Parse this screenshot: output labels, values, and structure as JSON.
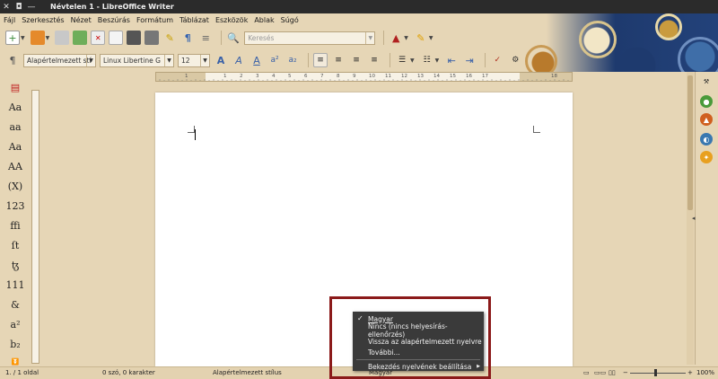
{
  "window": {
    "title": "Névtelen 1 - LibreOffice Writer",
    "close_glyph": "✕",
    "maximize_glyph": "◘",
    "minimize_glyph": "—"
  },
  "menu": [
    "Fájl",
    "Szerkesztés",
    "Nézet",
    "Beszúrás",
    "Formátum",
    "Táblázat",
    "Eszközök",
    "Ablak",
    "Súgó"
  ],
  "toolbar": {
    "search_placeholder": "Keresés",
    "paragraph_style": "Alapértelmezett stí",
    "font_name": "Linux Libertine G",
    "font_size": "12"
  },
  "ruler": {
    "numbers": [
      "1",
      "1",
      "2",
      "3",
      "4",
      "5",
      "6",
      "7",
      "8",
      "9",
      "10",
      "11",
      "12",
      "13",
      "14",
      "15",
      "16",
      "17",
      "18"
    ]
  },
  "sidebar_styles": [
    "Aa",
    "aa",
    "Aa",
    "AA",
    "(X)",
    "123",
    "ffi",
    "ſt",
    "ꜩ",
    "111",
    "&",
    "a²",
    "b₂"
  ],
  "statusbar": {
    "page": "1. / 1 oldal",
    "words": "0 szó, 0 karakter",
    "style": "Alapértelmezett stílus",
    "language": "Magyar",
    "zoom": "100%"
  },
  "context_menu": {
    "items": [
      {
        "label": "Magyar",
        "checked": true
      },
      {
        "label": "Nincs (nincs helyesírás-ellenőrzés)"
      },
      {
        "label": "Vissza az alapértelmezett nyelvre"
      },
      {
        "label": "További..."
      },
      {
        "label": "Bekezdés nyelvének beállítása",
        "submenu": true
      }
    ],
    "check_glyph": "✓",
    "submenu_glyph": "▶"
  },
  "colors": {
    "background": "#e6d6b6",
    "menu_bg": "#3a3a3a",
    "highlight_border": "#8b1a1a"
  }
}
